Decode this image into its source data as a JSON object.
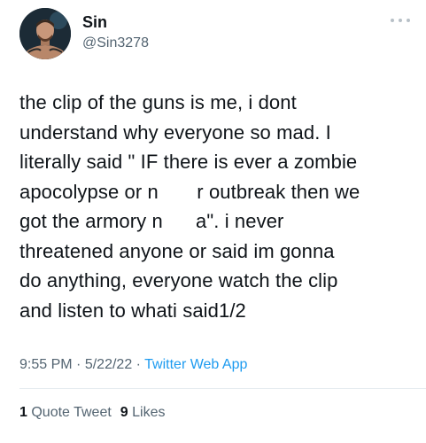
{
  "user": {
    "display_name": "Sin",
    "handle": "@Sin3278",
    "avatar_icon": "profile-photo"
  },
  "tweet": {
    "lines": [
      "the clip of the guns is me, i dont",
      "understand why everyone so mad. I",
      "literally said \" IF there is ever a zombie",
      "apocolypse or n       r outbreak then we",
      "got the armory n      a\". i never",
      "threatened anyone or said im gonna",
      "do anything, everyone watch the clip",
      "and listen to whati said1/2"
    ]
  },
  "meta": {
    "time": "9:55 PM",
    "separator": "·",
    "date": "5/22/22",
    "source": "Twitter Web App"
  },
  "stats": {
    "quote_count": "1",
    "quote_label": "Quote Tweet",
    "like_count": "9",
    "like_label": "Likes"
  },
  "colors": {
    "text": "#0f1419",
    "secondary": "#536471",
    "link": "#1d9bf0"
  }
}
